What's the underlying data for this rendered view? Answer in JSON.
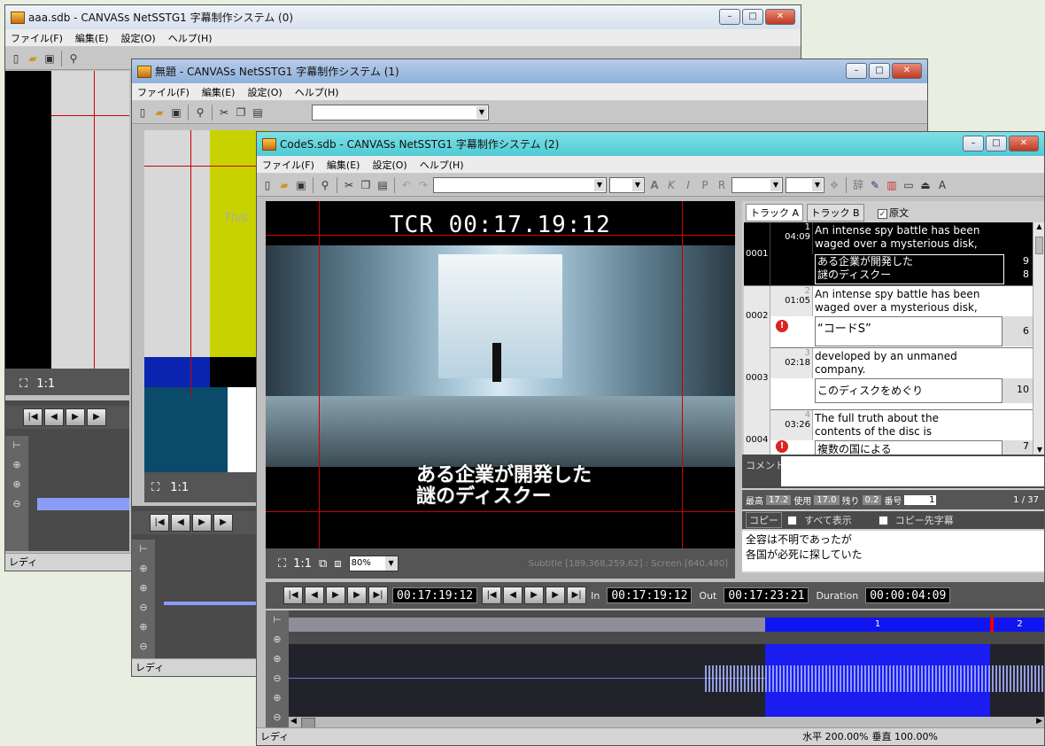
{
  "windows": [
    {
      "title": "aaa.sdb - CANVASs NetSSTG1 字幕制作システム (0)",
      "menu": [
        "ファイル(F)",
        "編集(E)",
        "設定(O)",
        "ヘルプ(H)"
      ],
      "zoom_ratio": "1:1",
      "status": "レディ"
    },
    {
      "title": "無題 - CANVASs NetSSTG1 字幕制作システム (1)",
      "menu": [
        "ファイル(F)",
        "編集(E)",
        "設定(O)",
        "ヘルプ(H)"
      ],
      "zoom_ratio": "1:1",
      "preview_text": "This",
      "status": "レディ"
    },
    {
      "title": "CodeS.sdb - CANVASs NetSSTG1 字幕制作システム (2)",
      "menu": [
        "ファイル(F)",
        "編集(E)",
        "設定(O)",
        "ヘルプ(H)"
      ],
      "status": "レディ"
    }
  ],
  "main": {
    "tcr": "TCR 00:17.19:12",
    "subtitle_line1": "ある企業が開発した",
    "subtitle_line2": "謎のディスクー",
    "zoom_ratio": "1:1",
    "zoom_value": "80%",
    "subtitle_info": "Subtitle [189,368,259,62] : Screen [640,480]",
    "tc_current": "00:17:19:12",
    "in_label": "In",
    "in_tc": "00:17:19:12",
    "out_label": "Out",
    "out_tc": "00:17:23:21",
    "duration_label": "Duration",
    "duration_tc": "00:00:04:09",
    "clip1": "1",
    "clip2": "2",
    "status_h": "水平 200.00%",
    "status_v": "垂直 100.00%"
  },
  "panel": {
    "tab_a": "トラック A",
    "tab_b": "トラック B",
    "original_label": "原文",
    "rows": [
      {
        "index": "1",
        "time": "04:09",
        "id": "0001",
        "en1": "An intense spy battle has been",
        "en2": "waged over a mysterious disk,",
        "jp1": "ある企業が開発した",
        "jp2": "謎のディスクー",
        "count1": "9",
        "count2": "8"
      },
      {
        "index": "2",
        "time": "01:05",
        "id": "0002",
        "en1": "An intense spy battle has been",
        "en2": "waged over a mysterious disk,",
        "jp1": "“コードS”",
        "count1": "6"
      },
      {
        "index": "3",
        "time": "02:18",
        "id": "0003",
        "en1": "developed by an unmaned",
        "en2": "company.",
        "jp1": "このディスクをめぐり",
        "count1": "10"
      },
      {
        "index": "4",
        "time": "03:26",
        "id": "0004",
        "en1": "The full truth about the",
        "en2": "contents of the disc is",
        "jp1": "複数の国による",
        "count1": "7"
      }
    ],
    "comment_label": "コメント",
    "max_label": "最高",
    "max_value": "17.2",
    "used_label": "使用",
    "used_value": "17.0",
    "remain_label": "残り",
    "remain_value": "0.2",
    "number_label": "番号",
    "number_value": "1",
    "page": "1 / 37",
    "copy_label": "コピー",
    "show_all_label": "すべて表示",
    "copy_dest_label": "コピー先字幕",
    "source_line1": "全容は不明であったが",
    "source_line2": "各国が必死に探していた"
  }
}
